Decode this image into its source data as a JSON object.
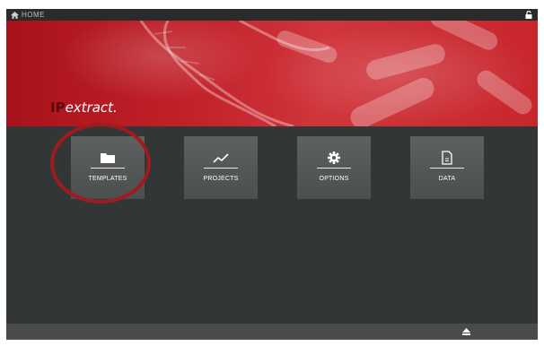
{
  "topbar": {
    "home_label": "HOME",
    "home_icon": "home-icon",
    "lock_icon": "lock-icon"
  },
  "banner": {
    "logo_prefix": "IP",
    "logo_text": "extract."
  },
  "tiles": [
    {
      "label": "TEMPLATES",
      "icon": "folder-icon",
      "highlighted": true
    },
    {
      "label": "PROJECTS",
      "icon": "chart-line-icon"
    },
    {
      "label": "OPTIONS",
      "icon": "gear-icon"
    },
    {
      "label": "DATA",
      "icon": "document-icon"
    }
  ],
  "bottombar": {
    "icon": "eject-icon"
  },
  "colors": {
    "banner": "#c2222a",
    "background": "#333636",
    "tile": "#555858",
    "highlight_circle": "#a01a1e"
  }
}
